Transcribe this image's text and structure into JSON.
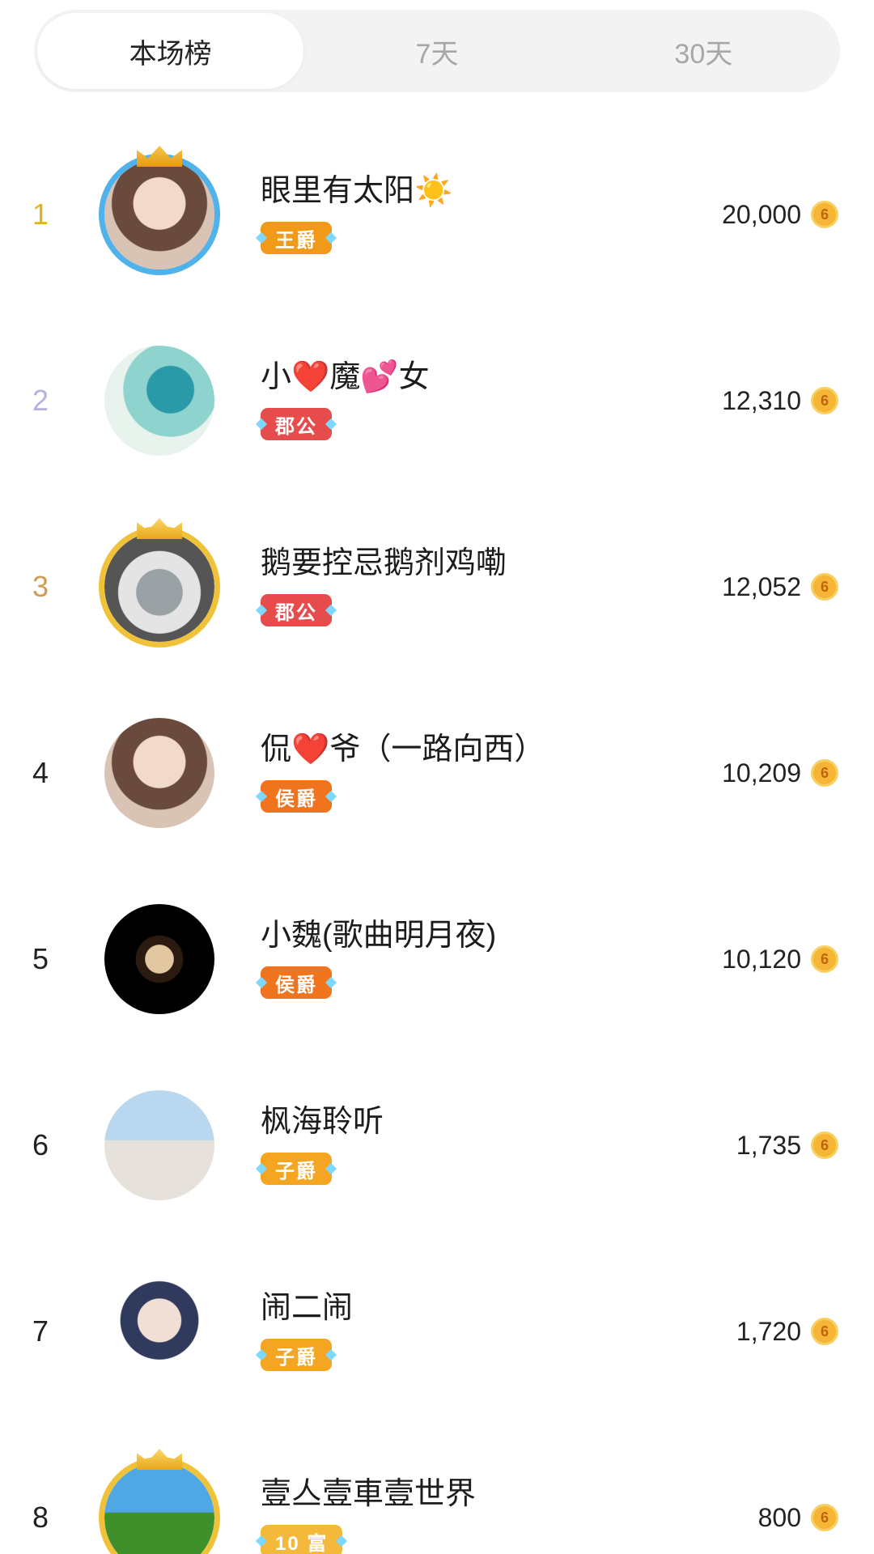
{
  "tabs": [
    {
      "label": "本场榜",
      "active": true
    },
    {
      "label": "7天",
      "active": false
    },
    {
      "label": "30天",
      "active": false
    }
  ],
  "coin_symbol": "6",
  "colors": {
    "rank1": "#e6b21c",
    "rank2": "#b3b3e0",
    "rank3": "#d39a55",
    "rank_default": "#222222",
    "badge_wangjue": "#f19a1a",
    "badge_jungong": "#e64c4c",
    "badge_houjue": "#f0731e",
    "badge_zijue": "#f4a623",
    "badge_fu": "#f3b93a"
  },
  "rows": [
    {
      "rank": "1",
      "name": "眼里有太阳☀️",
      "badge": "王爵",
      "badge_type": "wangjue",
      "score": "20,000",
      "avatar_icon": "avatar-woman-icon"
    },
    {
      "rank": "2",
      "name": "小❤️魔💕女",
      "badge": "郡公",
      "badge_type": "jungong",
      "score": "12,310",
      "avatar_icon": "avatar-dragon-icon"
    },
    {
      "rank": "3",
      "name": "鹅要控忌鹅剂鸡嘞",
      "badge": "郡公",
      "badge_type": "jungong",
      "score": "12,052",
      "avatar_icon": "avatar-cat-icon"
    },
    {
      "rank": "4",
      "name": "侃❤️爷（一路向西）",
      "badge": "侯爵",
      "badge_type": "houjue",
      "score": "10,209",
      "avatar_icon": "avatar-woman-icon"
    },
    {
      "rank": "5",
      "name": "小魏(歌曲明月夜)",
      "badge": "侯爵",
      "badge_type": "houjue",
      "score": "10,120",
      "avatar_icon": "avatar-dark-icon"
    },
    {
      "rank": "6",
      "name": "枫海聆听",
      "badge": "子爵",
      "badge_type": "zijue",
      "score": "1,735",
      "avatar_icon": "avatar-couple-icon"
    },
    {
      "rank": "7",
      "name": "闹二闹",
      "badge": "子爵",
      "badge_type": "zijue",
      "score": "1,720",
      "avatar_icon": "avatar-cartoon-icon"
    },
    {
      "rank": "8",
      "name": "壹亼壹車壹世界",
      "badge": "10 富",
      "badge_type": "fu",
      "score": "800",
      "avatar_icon": "avatar-landscape-icon"
    }
  ]
}
